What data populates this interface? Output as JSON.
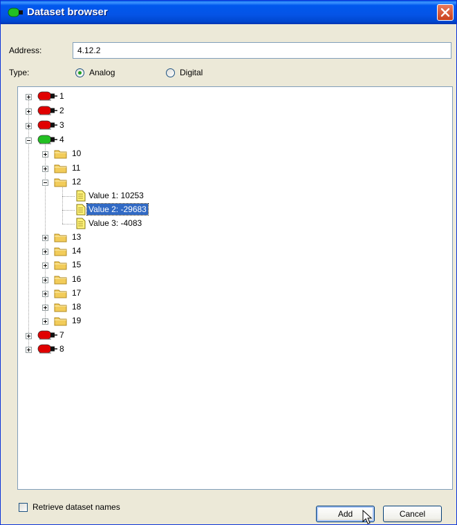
{
  "window": {
    "title": "Dataset browser"
  },
  "address": {
    "label": "Address:",
    "value": "4.12.2"
  },
  "type": {
    "label": "Type:",
    "options": [
      "Analog",
      "Digital"
    ],
    "selected": "Analog"
  },
  "tree": {
    "n1": "1",
    "n2": "2",
    "n3": "3",
    "n4": "4",
    "n10": "10",
    "n11": "11",
    "n12": "12",
    "v1": "Value 1: 10253",
    "v2": "Value 2: -29683",
    "v3": "Value 3: -4083",
    "n13": "13",
    "n14": "14",
    "n15": "15",
    "n16": "16",
    "n17": "17",
    "n18": "18",
    "n19": "19",
    "n7": "7",
    "n8": "8",
    "selected": "Value 2: -29683"
  },
  "footer": {
    "retrieve_label": "Retrieve dataset names",
    "retrieve_checked": false
  },
  "buttons": {
    "add": "Add",
    "cancel": "Cancel"
  },
  "colors": {
    "device_offline": "#E00000",
    "device_online": "#22C022",
    "folder": "#F2CC5A",
    "selection": "#316AC5"
  },
  "icons": {
    "device": "plug-icon",
    "folder": "folder-icon",
    "value": "document-icon"
  }
}
